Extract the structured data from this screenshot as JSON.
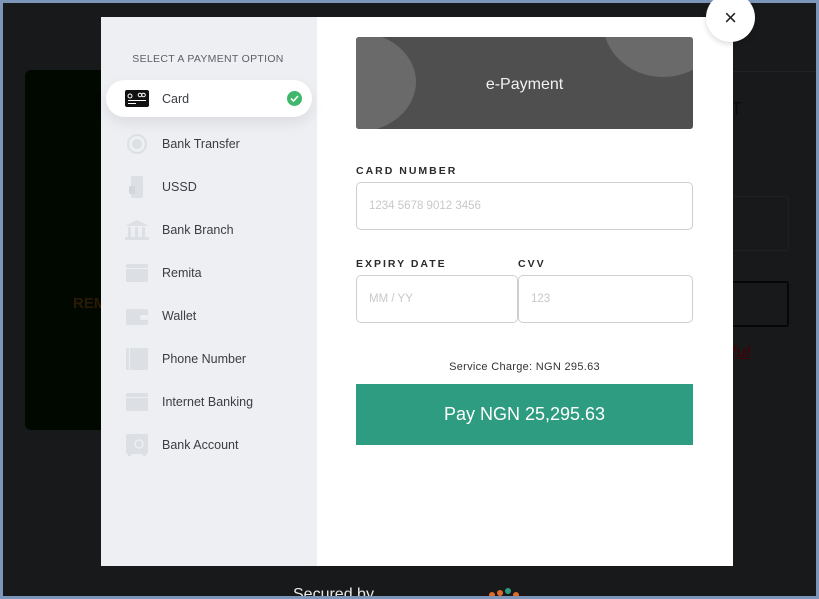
{
  "background": {
    "card_text": "REM",
    "panel_text": "T",
    "link_text": "ful",
    "footer_text": "Secured by"
  },
  "modal": {
    "sidebar": {
      "title": "SELECT A PAYMENT OPTION",
      "items": [
        {
          "label": "Card",
          "icon": "credit-card-icon",
          "active": true
        },
        {
          "label": "Bank Transfer",
          "icon": "bank-transfer-icon",
          "active": false
        },
        {
          "label": "USSD",
          "icon": "ussd-phone-icon",
          "active": false
        },
        {
          "label": "Bank Branch",
          "icon": "bank-building-icon",
          "active": false
        },
        {
          "label": "Remita",
          "icon": "remita-browser-icon",
          "active": false
        },
        {
          "label": "Wallet",
          "icon": "wallet-icon",
          "active": false
        },
        {
          "label": "Phone Number",
          "icon": "phone-book-icon",
          "active": false
        },
        {
          "label": "Internet Banking",
          "icon": "internet-banking-icon",
          "active": false
        },
        {
          "label": "Bank Account",
          "icon": "bank-safe-icon",
          "active": false
        }
      ]
    },
    "banner": {
      "title": "e-Payment"
    },
    "form": {
      "card_number_label": "CARD NUMBER",
      "card_number_placeholder": "1234 5678 9012 3456",
      "card_number_value": "",
      "expiry_label": "EXPIRY DATE",
      "expiry_placeholder": "MM / YY",
      "expiry_value": "",
      "cvv_label": "CVV",
      "cvv_placeholder": "123",
      "cvv_value": ""
    },
    "service_charge": "Service Charge: NGN 295.63",
    "pay_button": "Pay NGN 25,295.63",
    "close_label": "×"
  },
  "colors": {
    "accent": "#2e9c80",
    "check": "#3fb86b",
    "sidebar_bg": "#edeff2",
    "banner_bg": "#4f4f4f"
  }
}
